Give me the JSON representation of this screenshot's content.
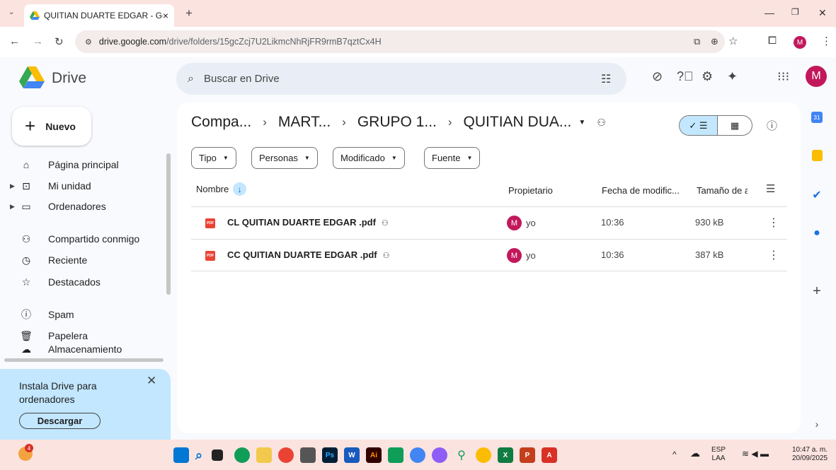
{
  "browser": {
    "tab_title": "QUITIAN DUARTE EDGAR - Goo",
    "tab_close": "×",
    "new_tab": "+",
    "url_host": "drive.google.com",
    "url_path": "/drive/folders/15gcZcj7U2LikmcNhRjFR9rmB7qztCx4H",
    "profile_initial": "M"
  },
  "app": {
    "name": "Drive",
    "search_placeholder": "Buscar en Drive",
    "avatar_initial": "M"
  },
  "sidebar": {
    "new_label": "Nuevo",
    "items": [
      {
        "label": "Página principal",
        "icon": "home-icon"
      },
      {
        "label": "Mi unidad",
        "icon": "drive-icon"
      },
      {
        "label": "Ordenadores",
        "icon": "computer-icon"
      },
      {
        "label": "Compartido conmigo",
        "icon": "people-icon"
      },
      {
        "label": "Reciente",
        "icon": "clock-icon"
      },
      {
        "label": "Destacados",
        "icon": "star-icon"
      },
      {
        "label": "Spam",
        "icon": "spam-icon"
      },
      {
        "label": "Papelera",
        "icon": "trash-icon"
      },
      {
        "label": "Almacenamiento",
        "icon": "cloud-icon"
      }
    ],
    "promo_text": "Instala Drive para ordenadores",
    "promo_button": "Descargar"
  },
  "breadcrumb": {
    "items": [
      "Compa...",
      "MART...",
      "GRUPO 1...",
      "QUITIAN DUA..."
    ],
    "separator": "›"
  },
  "filters": [
    "Tipo",
    "Personas",
    "Modificado",
    "Fuente"
  ],
  "table": {
    "headers": {
      "name": "Nombre",
      "owner": "Propietario",
      "modified": "Fecha de modific...",
      "size": "Tamaño de a"
    },
    "rows": [
      {
        "name": "CL QUITIAN DUARTE EDGAR .pdf",
        "owner": "yo",
        "owner_initial": "M",
        "modified": "10:36",
        "size": "930 kB"
      },
      {
        "name": "CC QUITIAN DUARTE EDGAR .pdf",
        "owner": "yo",
        "owner_initial": "M",
        "modified": "10:36",
        "size": "387 kB"
      }
    ]
  },
  "taskbar": {
    "lang": "ESP",
    "lang_sub": "LAA",
    "time": "10:47 a. m.",
    "date": "20/09/2025",
    "badge": "4"
  },
  "colors": {
    "accent": "#0b57d0",
    "avatar": "#c2185b",
    "pdf": "#ea4335",
    "chrome_frame": "#fbe3df",
    "selected_toggle": "#c2e7ff"
  }
}
